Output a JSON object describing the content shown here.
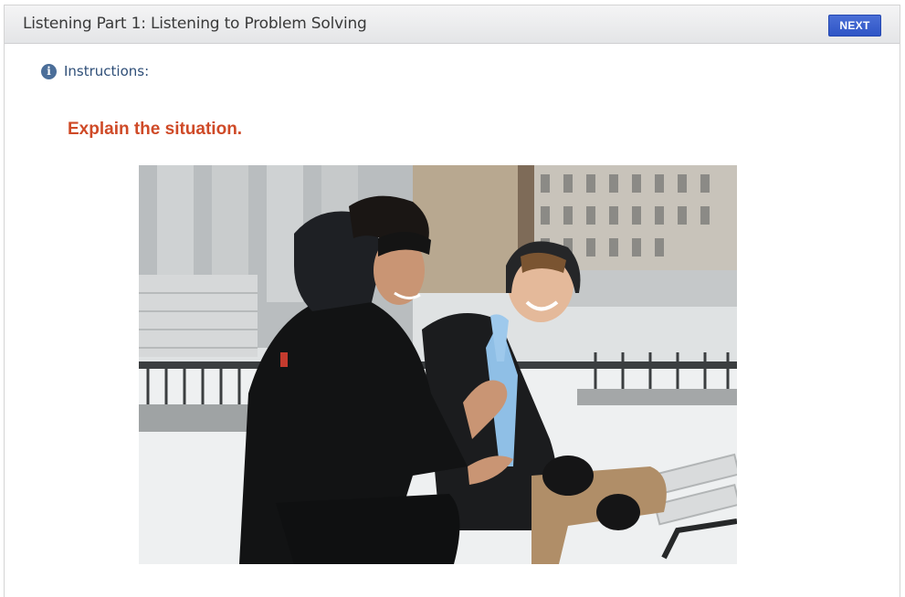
{
  "header": {
    "title": "Listening Part 1: Listening to Problem Solving",
    "next_label": "NEXT"
  },
  "instructions": {
    "icon": "info-icon",
    "label": "Instructions:"
  },
  "task": {
    "prompt": "Explain the situation."
  },
  "photo": {
    "description_icon": "photo-two-men-talking-on-snowy-bench"
  },
  "colors": {
    "accent_button": "#3659c9",
    "prompt_text": "#cf4a27",
    "instructions_text": "#2f4f78"
  }
}
